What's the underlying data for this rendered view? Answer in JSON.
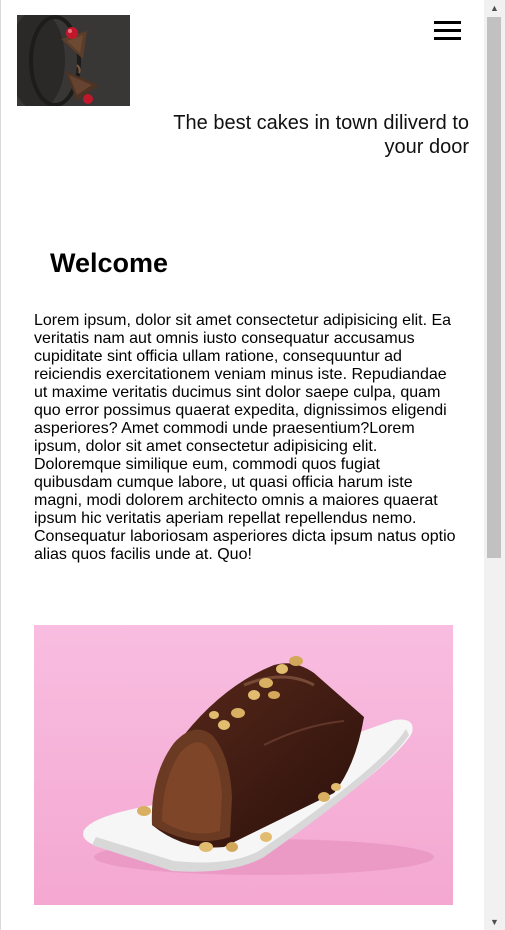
{
  "header": {
    "logo_icon": "cake-slice-logo",
    "menu_icon": "hamburger-menu-icon",
    "tagline": "The best cakes in town diliverd to your door"
  },
  "main": {
    "heading": "Welcome",
    "intro": "Lorem ipsum, dolor sit amet consectetur adipisicing elit. Ea veritatis nam aut omnis iusto consequatur accusamus cupiditate sint officia ullam ratione, consequuntur ad reiciendis exercitationem veniam minus iste. Repudiandae ut maxime veritatis ducimus sint dolor saepe culpa, quam quo error possimus quaerat expedita, dignissimos eligendi asperiores? Amet commodi unde praesentium?Lorem ipsum, dolor sit amet consectetur adipisicing elit. Doloremque similique eum, commodi quos fugiat quibusdam cumque labore, ut quasi officia harum iste magni, modi dolorem architecto omnis a maiores quaerat ipsum hic veritatis aperiam repellat repellendus nemo. Consequatur laboriosam asperiores dicta ipsum natus optio alias quos facilis unde at. Quo!",
    "feature_image": "chocolate-cake-on-pink-photo"
  },
  "scrollbar": {
    "up_icon": "scroll-up-arrow-icon",
    "down_icon": "scroll-down-arrow-icon"
  },
  "colors": {
    "image_background_pink": "#f7b8d8",
    "logo_background": "#3a3838",
    "cake_chocolate": "#4a2418",
    "scrollbar_track": "#f1f1f1",
    "scrollbar_thumb": "#c1c1c1"
  }
}
